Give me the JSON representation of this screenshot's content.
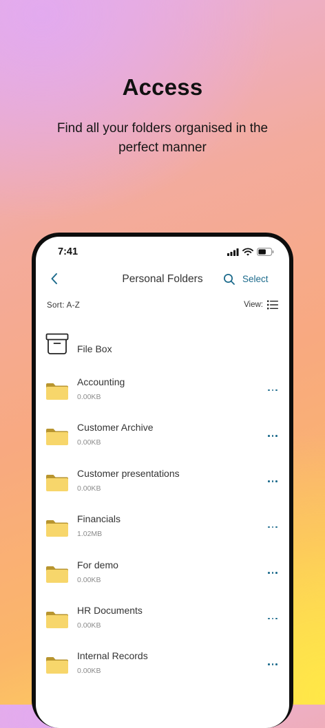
{
  "marketing": {
    "headline": "Access",
    "subline": "Find all your folders organised in the perfect manner"
  },
  "status_bar": {
    "time": "7:41",
    "icons": [
      "signal-icon",
      "wifi-icon",
      "battery-icon"
    ]
  },
  "header": {
    "title": "Personal Folders",
    "select_label": "Select"
  },
  "toolbar": {
    "sort_label": "Sort: A-Z",
    "view_label": "View:"
  },
  "file_box": {
    "label": "File Box"
  },
  "folders": [
    {
      "name": "Accounting",
      "size": "0.00KB"
    },
    {
      "name": "Customer Archive",
      "size": "0.00KB"
    },
    {
      "name": "Customer presentations",
      "size": "0.00KB"
    },
    {
      "name": "Financials",
      "size": "1.02MB"
    },
    {
      "name": "For demo",
      "size": "0.00KB"
    },
    {
      "name": "HR Documents",
      "size": "0.00KB"
    },
    {
      "name": "Internal Records",
      "size": "0.00KB"
    }
  ],
  "colors": {
    "accent": "#1d6b8c",
    "folder_body": "#f7d66b",
    "folder_tab": "#b8952f"
  }
}
